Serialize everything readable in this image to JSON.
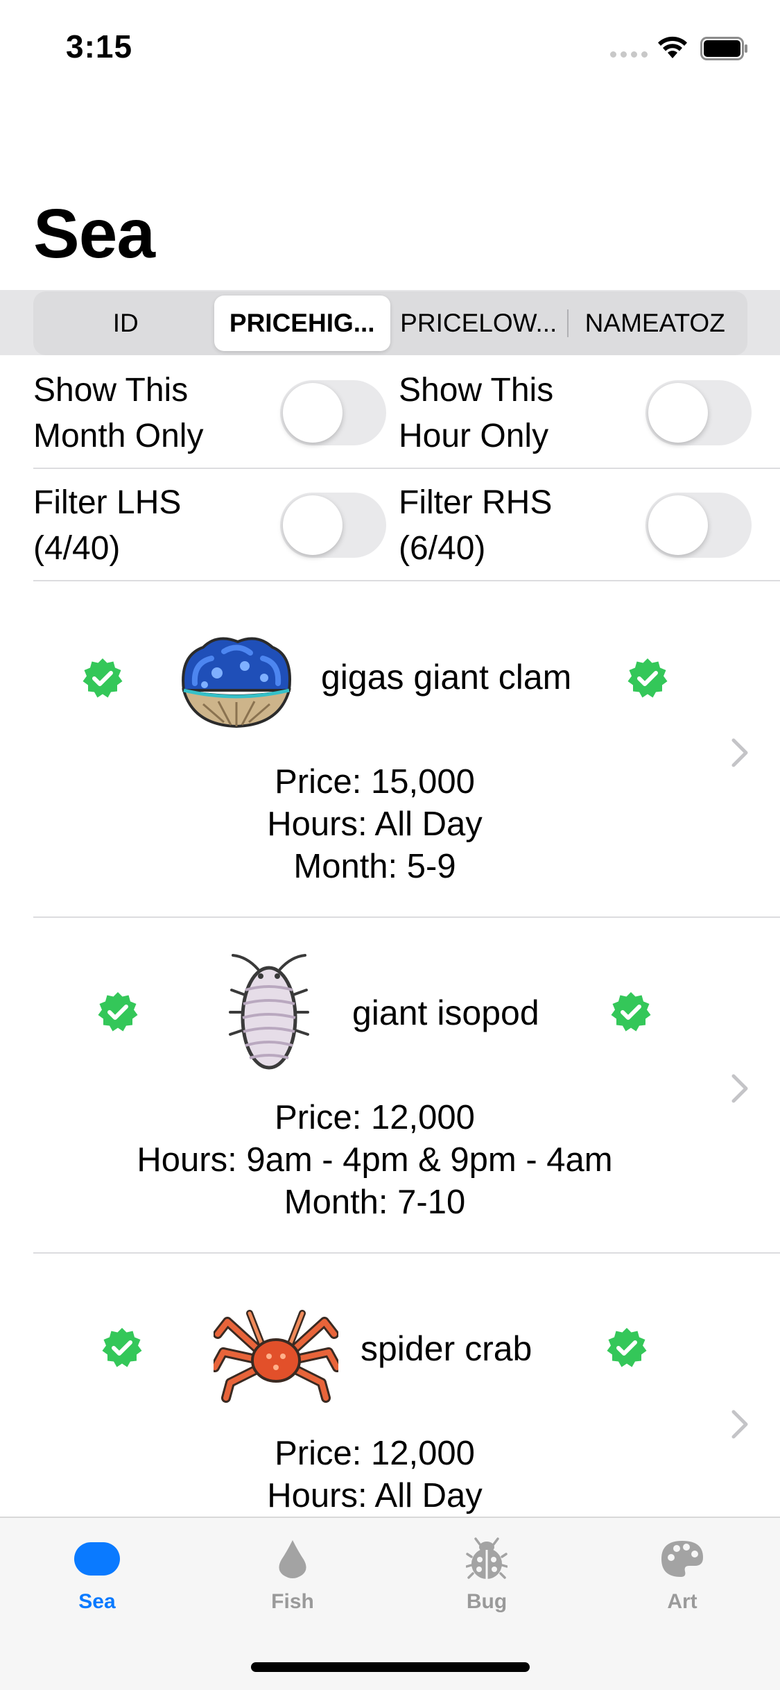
{
  "status_bar": {
    "time": "3:15"
  },
  "title": "Sea",
  "segmented_control": {
    "segments": [
      "ID",
      "PRICEHIG...",
      "PRICELOW...",
      "NAMEATOZ"
    ],
    "selected_index": 1
  },
  "filters": {
    "show_this_month_only": {
      "label": "Show This Month Only",
      "on": false
    },
    "show_this_hour_only": {
      "label": "Show This Hour Only",
      "on": false
    },
    "filter_lhs": {
      "label": "Filter LHS (4/40)",
      "on": false
    },
    "filter_rhs": {
      "label": "Filter RHS (6/40)",
      "on": false
    }
  },
  "items": [
    {
      "name": "gigas giant clam",
      "price": "Price: 15,000",
      "hours": "Hours: All Day",
      "month": "Month: 5-9",
      "icon": "giant-clam-icon"
    },
    {
      "name": "giant isopod",
      "price": "Price: 12,000",
      "hours": "Hours: 9am - 4pm & 9pm - 4am",
      "month": "Month: 7-10",
      "icon": "isopod-icon"
    },
    {
      "name": "spider crab",
      "price": "Price: 12,000",
      "hours": "Hours: All Day",
      "month": "",
      "icon": "spider-crab-icon"
    }
  ],
  "tab_bar": {
    "tabs": [
      {
        "label": "Sea",
        "icon": "sea-icon",
        "active": true
      },
      {
        "label": "Fish",
        "icon": "drop-icon",
        "active": false
      },
      {
        "label": "Bug",
        "icon": "ladybug-icon",
        "active": false
      },
      {
        "label": "Art",
        "icon": "palette-icon",
        "active": false
      }
    ]
  },
  "colors": {
    "accent": "#0a7aff",
    "badge_green": "#34c759",
    "toggle_off": "#e9e9eb"
  }
}
